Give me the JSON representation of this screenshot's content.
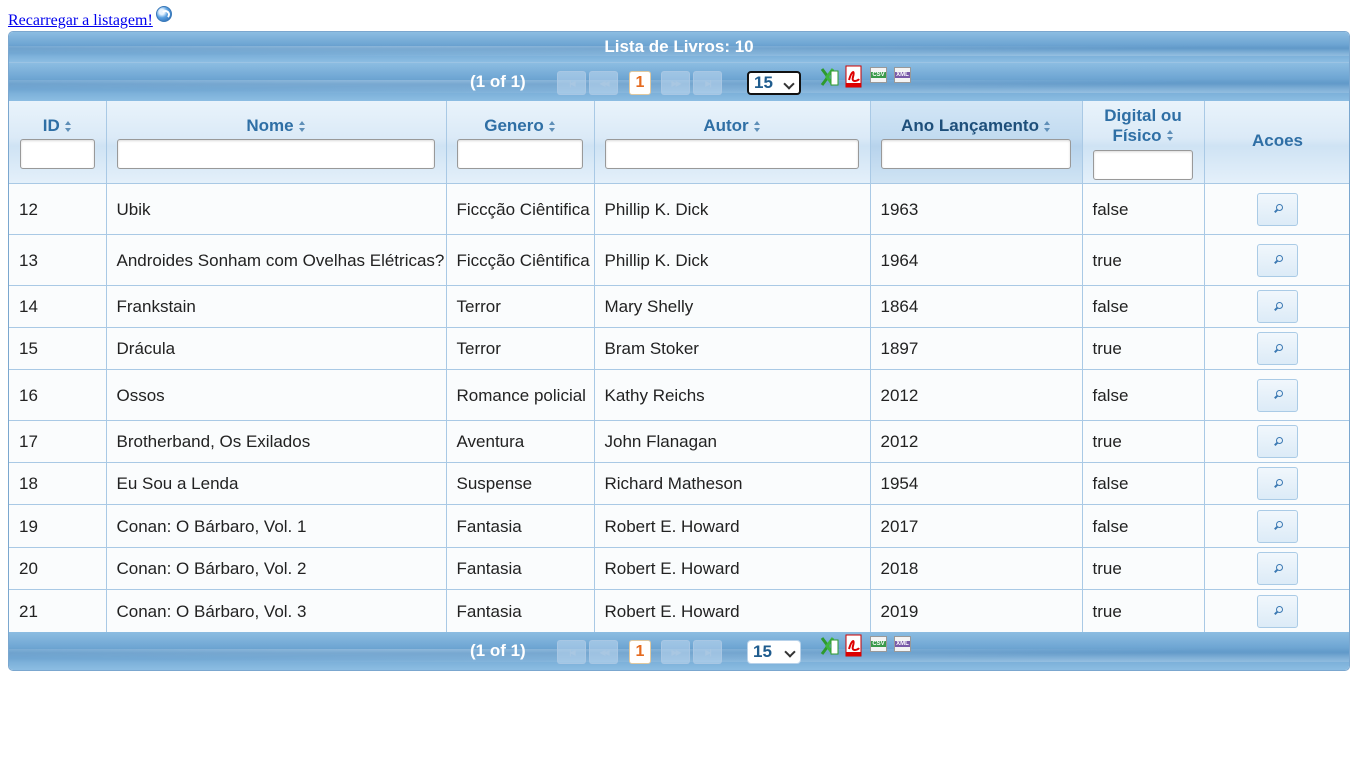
{
  "reload": {
    "link_text": "Recarregar a listagem!"
  },
  "panel": {
    "title": "Lista de Livros: 10"
  },
  "paginator": {
    "count_text": "(1 of 1)",
    "current_page": "1",
    "rows_per_page": "15"
  },
  "columns": {
    "id": "ID",
    "nome": "Nome",
    "genero": "Genero",
    "autor": "Autor",
    "ano": "Ano Lançamento",
    "digital_line1": "Digital ou",
    "digital_line2": "Físico",
    "acoes": "Acoes"
  },
  "rows": [
    {
      "id": "12",
      "nome": "Ubik",
      "genero": "Ficcção Ciêntifica",
      "autor": "Phillip K. Dick",
      "ano": "1963",
      "digital": "false"
    },
    {
      "id": "13",
      "nome": "Androides Sonham com Ovelhas Elétricas?",
      "genero": "Ficcção Ciêntifica",
      "autor": "Phillip K. Dick",
      "ano": "1964",
      "digital": "true"
    },
    {
      "id": "14",
      "nome": "Frankstain",
      "genero": "Terror",
      "autor": "Mary Shelly",
      "ano": "1864",
      "digital": "false"
    },
    {
      "id": "15",
      "nome": "Drácula",
      "genero": "Terror",
      "autor": "Bram Stoker",
      "ano": "1897",
      "digital": "true"
    },
    {
      "id": "16",
      "nome": "Ossos",
      "genero": "Romance policial",
      "autor": "Kathy Reichs",
      "ano": "2012",
      "digital": "false"
    },
    {
      "id": "17",
      "nome": "Brotherband, Os Exilados",
      "genero": "Aventura",
      "autor": "John Flanagan",
      "ano": "2012",
      "digital": "true"
    },
    {
      "id": "18",
      "nome": "Eu Sou a Lenda",
      "genero": "Suspense",
      "autor": "Richard Matheson",
      "ano": "1954",
      "digital": "false"
    },
    {
      "id": "19",
      "nome": "Conan: O Bárbaro, Vol. 1",
      "genero": "Fantasia",
      "autor": "Robert E. Howard",
      "ano": "2017",
      "digital": "false"
    },
    {
      "id": "20",
      "nome": "Conan: O Bárbaro, Vol. 2",
      "genero": "Fantasia",
      "autor": "Robert E. Howard",
      "ano": "2018",
      "digital": "true"
    },
    {
      "id": "21",
      "nome": "Conan: O Bárbaro, Vol. 3",
      "genero": "Fantasia",
      "autor": "Robert E. Howard",
      "ano": "2019",
      "digital": "true"
    }
  ],
  "export_icons": [
    "excel-icon",
    "pdf-icon",
    "csv-icon",
    "xml-icon"
  ],
  "colors": {
    "header_bar": "#6fa6d3",
    "header_text": "#2f6fa5",
    "page_active": "#e56a1f",
    "grid_line": "#a9c9e5"
  }
}
